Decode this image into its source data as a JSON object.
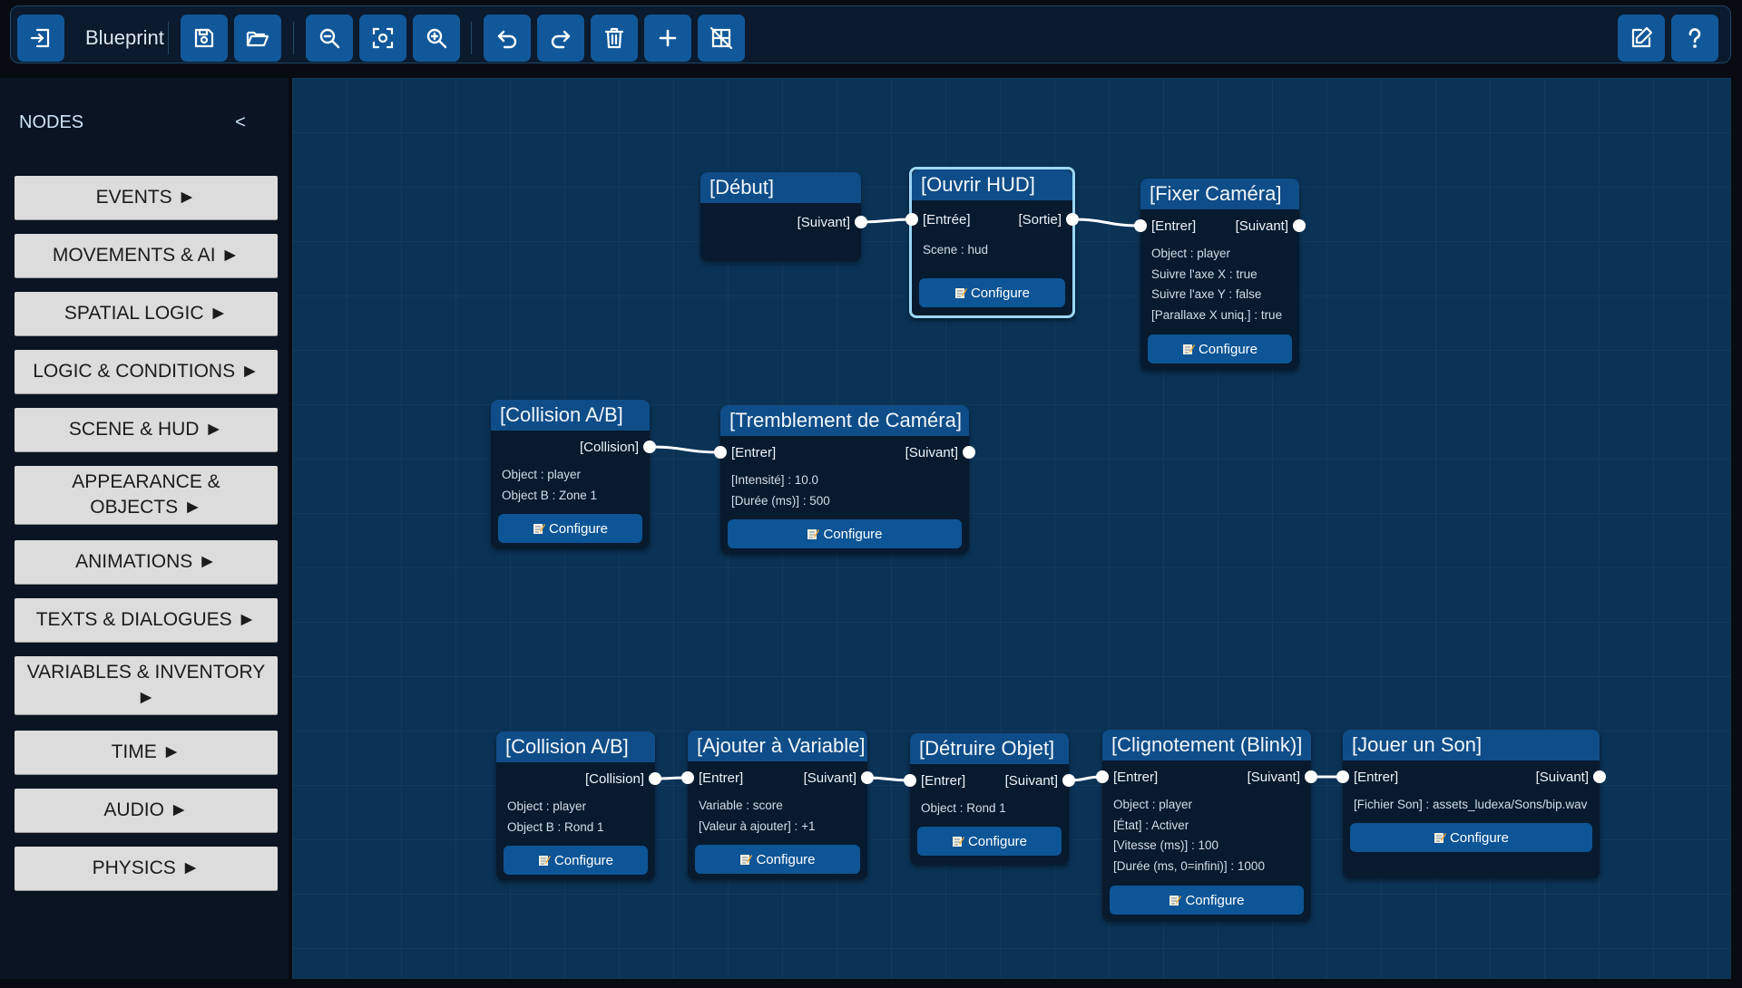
{
  "toolbar": {
    "title": "Blueprint",
    "buttons": [
      {
        "name": "exit-button",
        "icon": "exit-icon"
      },
      {
        "name": "save-button",
        "icon": "save-icon"
      },
      {
        "name": "open-button",
        "icon": "folder-open-icon"
      },
      {
        "name": "zoom-out-button",
        "icon": "zoom-out-icon"
      },
      {
        "name": "fit-view-button",
        "icon": "fit-view-icon"
      },
      {
        "name": "zoom-in-button",
        "icon": "zoom-in-icon"
      },
      {
        "name": "undo-button",
        "icon": "undo-icon"
      },
      {
        "name": "redo-button",
        "icon": "redo-icon"
      },
      {
        "name": "delete-button",
        "icon": "trash-icon"
      },
      {
        "name": "add-button",
        "icon": "plus-icon"
      },
      {
        "name": "toggle-grid-button",
        "icon": "grid-off-icon"
      },
      {
        "name": "edit-button",
        "icon": "edit-icon"
      },
      {
        "name": "help-button",
        "icon": "help-icon"
      }
    ]
  },
  "sidebar": {
    "title": "NODES",
    "collapse_label": "<",
    "categories": [
      "EVENTS ►",
      "MOVEMENTS & AI ►",
      "SPATIAL LOGIC ►",
      "LOGIC & CONDITIONS ►",
      "SCENE & HUD ►",
      "APPEARANCE & OBJECTS ►",
      "ANIMATIONS ►",
      "TEXTS & DIALOGUES ►",
      "VARIABLES & INVENTORY ►",
      "TIME ►",
      "AUDIO ►",
      "PHYSICS ►"
    ]
  },
  "configure_label": "Configure",
  "colors": {
    "canvas": "#0b3356",
    "node_header": "#0f4d88",
    "node_body": "#071a2e",
    "button": "#11589a",
    "selected_border": "#9cd8f6"
  },
  "nodes": [
    {
      "id": "debut",
      "title": "[Début]",
      "in": "",
      "out": "[Suivant]",
      "fields": [],
      "configure": false
    },
    {
      "id": "ouvrir-hud",
      "title": "[Ouvrir HUD]",
      "in": "[Entrée]",
      "out": "[Sortie]",
      "fields": [
        "Scene : hud"
      ],
      "configure": true,
      "selected": true
    },
    {
      "id": "fixer-camera",
      "title": "[Fixer Caméra]",
      "in": "[Entrer]",
      "out": "[Suivant]",
      "fields": [
        "Object : player",
        "Suivre l'axe X : true",
        "Suivre l'axe Y : false",
        "[Parallaxe X uniq.] : true"
      ],
      "configure": true
    },
    {
      "id": "collision-1",
      "title": "[Collision A/B]",
      "in": "",
      "out": "[Collision]",
      "fields": [
        "Object : player",
        "Object B : Zone 1"
      ],
      "configure": true
    },
    {
      "id": "tremblement",
      "title": "[Tremblement de Caméra]",
      "in": "[Entrer]",
      "out": "[Suivant]",
      "fields": [
        "[Intensité] : 10.0",
        "[Durée (ms)] : 500"
      ],
      "configure": true
    },
    {
      "id": "collision-2",
      "title": "[Collision A/B]",
      "in": "",
      "out": "[Collision]",
      "fields": [
        "Object : player",
        "Object B : Rond 1"
      ],
      "configure": true
    },
    {
      "id": "ajouter-variable",
      "title": "[Ajouter à Variable]",
      "in": "[Entrer]",
      "out": "[Suivant]",
      "fields": [
        "Variable : score",
        "[Valeur à ajouter] : +1"
      ],
      "configure": true
    },
    {
      "id": "detruire-objet",
      "title": "[Détruire Objet]",
      "in": "[Entrer]",
      "out": "[Suivant]",
      "fields": [
        "Object : Rond 1"
      ],
      "configure": true
    },
    {
      "id": "clignotement",
      "title": "[Clignotement (Blink)]",
      "in": "[Entrer]",
      "out": "[Suivant]",
      "fields": [
        "Object : player",
        "[État] : Activer",
        "[Vitesse (ms)] : 100",
        "[Durée (ms, 0=infini)] : 1000"
      ],
      "configure": true
    },
    {
      "id": "jouer-son",
      "title": "[Jouer un Son]",
      "in": "[Entrer]",
      "out": "[Suivant]",
      "fields": [
        "[Fichier Son] : assets_ludexa/Sons/bip.wav"
      ],
      "configure": true
    }
  ],
  "links": [
    [
      "debut",
      "ouvrir-hud"
    ],
    [
      "ouvrir-hud",
      "fixer-camera"
    ],
    [
      "collision-1",
      "tremblement"
    ],
    [
      "collision-2",
      "ajouter-variable"
    ],
    [
      "ajouter-variable",
      "detruire-objet"
    ],
    [
      "detruire-objet",
      "clignotement"
    ],
    [
      "clignotement",
      "jouer-son"
    ]
  ]
}
